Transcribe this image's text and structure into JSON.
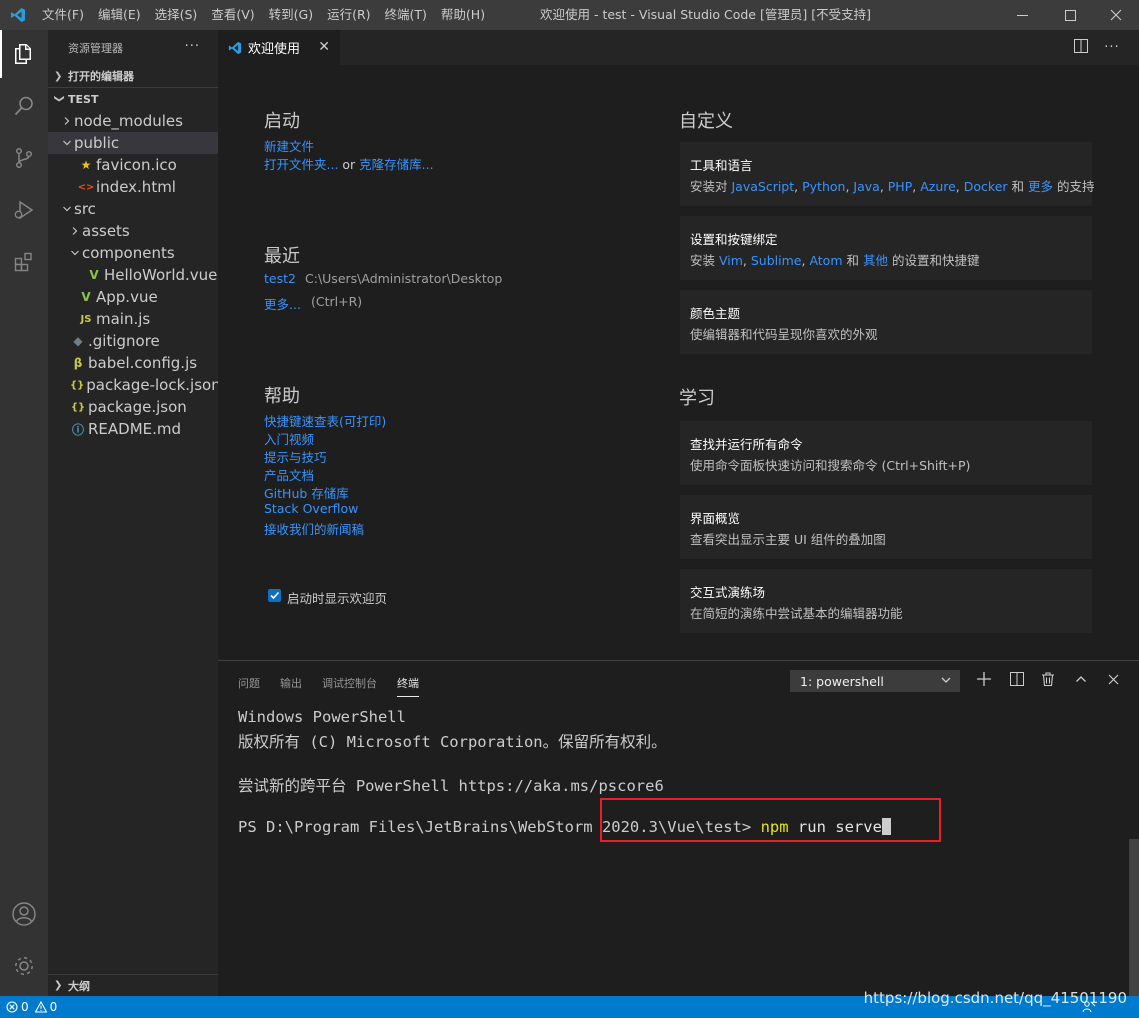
{
  "titlebar": {
    "menu": [
      "文件(F)",
      "编辑(E)",
      "选择(S)",
      "查看(V)",
      "转到(G)",
      "运行(R)",
      "终端(T)",
      "帮助(H)"
    ],
    "title": "欢迎使用 - test - Visual Studio Code [管理员] [不受支持]"
  },
  "sidebar": {
    "header": "资源管理器",
    "more": "···",
    "open_editors": "打开的编辑器",
    "project": "TEST",
    "tree": [
      {
        "label": "node_modules",
        "depth": 1,
        "kind": "folder-closed",
        "icon": "chevron-right-icon"
      },
      {
        "label": "public",
        "depth": 1,
        "kind": "folder-open",
        "icon": "chevron-down-icon",
        "selected": true
      },
      {
        "label": "favicon.ico",
        "depth": 2,
        "kind": "file",
        "icon": "star-icon",
        "color": "#f1c40f"
      },
      {
        "label": "index.html",
        "depth": 2,
        "kind": "file",
        "icon": "html-icon",
        "color": "#e44d26"
      },
      {
        "label": "src",
        "depth": 1,
        "kind": "folder-open",
        "icon": "chevron-down-icon"
      },
      {
        "label": "assets",
        "depth": 2,
        "kind": "folder-closed",
        "icon": "chevron-right-icon"
      },
      {
        "label": "components",
        "depth": 2,
        "kind": "folder-open",
        "icon": "chevron-down-icon"
      },
      {
        "label": "HelloWorld.vue",
        "depth": 3,
        "kind": "file",
        "icon": "vue-icon",
        "color": "#8dc149"
      },
      {
        "label": "App.vue",
        "depth": 2,
        "kind": "file",
        "icon": "vue-icon",
        "color": "#8dc149"
      },
      {
        "label": "main.js",
        "depth": 2,
        "kind": "file",
        "icon": "js-icon",
        "color": "#cbcb41"
      },
      {
        "label": ".gitignore",
        "depth": 1,
        "kind": "file",
        "icon": "git-icon",
        "color": "#6d8086"
      },
      {
        "label": "babel.config.js",
        "depth": 1,
        "kind": "file",
        "icon": "babel-icon",
        "color": "#cbcb41"
      },
      {
        "label": "package-lock.json",
        "depth": 1,
        "kind": "file",
        "icon": "json-icon",
        "color": "#cbcb41"
      },
      {
        "label": "package.json",
        "depth": 1,
        "kind": "file",
        "icon": "json-icon",
        "color": "#cbcb41"
      },
      {
        "label": "README.md",
        "depth": 1,
        "kind": "file",
        "icon": "info-icon",
        "color": "#519aba"
      }
    ],
    "outline": "大纲"
  },
  "editor": {
    "tab_label": "欢迎使用"
  },
  "welcome": {
    "start": {
      "title": "启动",
      "new_file": "新建文件",
      "open_folder": "打开文件夹...",
      "or": " or ",
      "clone": "克隆存储库..."
    },
    "recent": {
      "title": "最近",
      "item_name": "test2",
      "item_path": "C:\\Users\\Administrator\\Desktop",
      "more": "更多...",
      "more_shortcut": "(Ctrl+R)"
    },
    "help": {
      "title": "帮助",
      "links": [
        "快捷键速查表(可打印)",
        "入门视频",
        "提示与技巧",
        "产品文档",
        "GitHub 存储库",
        "Stack Overflow",
        "接收我们的新闻稿"
      ]
    },
    "show_on_startup": "启动时显示欢迎页",
    "customize": {
      "title": "自定义",
      "cards": [
        {
          "title": "工具和语言",
          "desc_prefix": "安装对 ",
          "links": [
            "JavaScript",
            "Python",
            "Java",
            "PHP",
            "Azure",
            "Docker"
          ],
          "and": " 和 ",
          "more": "更多",
          "desc_suffix": " 的支持"
        },
        {
          "title": "设置和按键绑定",
          "desc_prefix": "安装 ",
          "links": [
            "Vim",
            "Sublime",
            "Atom"
          ],
          "and": " 和 ",
          "more": "其他",
          "desc_suffix": " 的设置和快捷键"
        },
        {
          "title": "颜色主题",
          "desc": "使编辑器和代码呈现你喜欢的外观"
        }
      ]
    },
    "learn": {
      "title": "学习",
      "cards": [
        {
          "title": "查找并运行所有命令",
          "desc": "使用命令面板快速访问和搜索命令 (Ctrl+Shift+P)"
        },
        {
          "title": "界面概览",
          "desc": "查看突出显示主要 UI 组件的叠加图"
        },
        {
          "title": "交互式演练场",
          "desc": "在简短的演练中尝试基本的编辑器功能"
        }
      ]
    }
  },
  "panel": {
    "tabs": [
      "问题",
      "输出",
      "调试控制台",
      "终端"
    ],
    "active_tab": "终端",
    "terminal_select": "1: powershell",
    "terminal": {
      "line1": "Windows PowerShell",
      "line2": "版权所有 (C) Microsoft Corporation。保留所有权利。",
      "line3": "尝试新的跨平台 PowerShell https://aka.ms/pscore6",
      "prompt": "PS D:\\Program Files\\JetBrains\\WebStorm 2020.3\\Vue\\test> ",
      "command": "npm",
      "args": " run serve"
    }
  },
  "statusbar": {
    "errors": "0",
    "warnings": "0"
  },
  "watermark": "https://blog.csdn.net/qq_41501190",
  "colors": {
    "accent": "#007acc",
    "link": "#3794ff",
    "highlight_box": "#e8202a"
  }
}
